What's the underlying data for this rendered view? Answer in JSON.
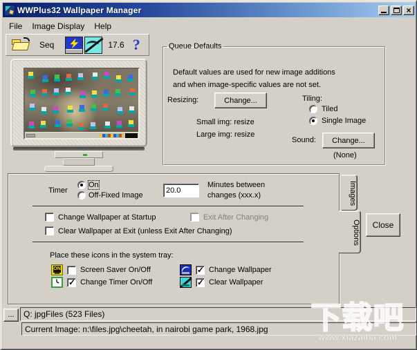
{
  "window": {
    "title": "WWPlus32 Wallpaper Manager"
  },
  "icons": {
    "close_glyph": "×",
    "tray_on_text": "ON"
  },
  "menu": {
    "items": [
      "File",
      "Image Display",
      "Help"
    ]
  },
  "toolbar": {
    "seq_label": "Seq",
    "counter": "17.6",
    "help_label": "?"
  },
  "queue_defaults": {
    "legend": "Queue Defaults",
    "description_line1": "Default values are used for new image additions",
    "description_line2": "and when image-specific values are not set.",
    "resizing_label": "Resizing:",
    "resizing_button": "Change...",
    "small_img": "Small img: resize",
    "large_img": "Large img: resize",
    "tiling_label": "Tiling:",
    "tiled_option": "Tiled",
    "single_option": "Single Image",
    "sound_label": "Sound:",
    "sound_button": "Change...",
    "sound_value": "(None)"
  },
  "tabs": {
    "images": "Images",
    "options": "Options"
  },
  "options_panel": {
    "timer_label": "Timer",
    "timer_on": "On",
    "timer_off": "Off-Fixed Image",
    "minutes_value": "20.0",
    "minutes_line1": "Minutes between",
    "minutes_line2": "changes (xxx.x)",
    "chk_startup": "Change Wallpaper at Startup",
    "chk_exit_after": "Exit After Changing",
    "chk_clear_exit": "Clear Wallpaper at Exit (unless Exit After Changing)",
    "tray_heading": "Place these icons in the system tray:",
    "tray_items": [
      {
        "label": "Screen Saver On/Off",
        "checked": false
      },
      {
        "label": "Change Wallpaper",
        "checked": true
      },
      {
        "label": "Change Timer On/Off",
        "checked": true
      },
      {
        "label": "Clear Wallpaper",
        "checked": true
      }
    ]
  },
  "states": {
    "tiled": false,
    "single_image": true,
    "timer_on": true,
    "timer_off": false,
    "chk_startup": false,
    "chk_exit_after": false,
    "chk_clear_exit": false
  },
  "close_button": "Close",
  "status": {
    "browse_button": "...",
    "queue_info": "Q: jpgFiles (523 Files)",
    "current_image": "Current Image: n:\\files.jpg\\cheetah, in nairobi game park, 1968.jpg"
  },
  "watermark": {
    "text": "下载吧",
    "url": "www.xiazaiba.com"
  },
  "colors": {
    "titlebar_left": "#08216b",
    "titlebar_right": "#a8cdf0",
    "window_bg": "#d4d0c8",
    "help_blue": "#2a3cc8"
  }
}
